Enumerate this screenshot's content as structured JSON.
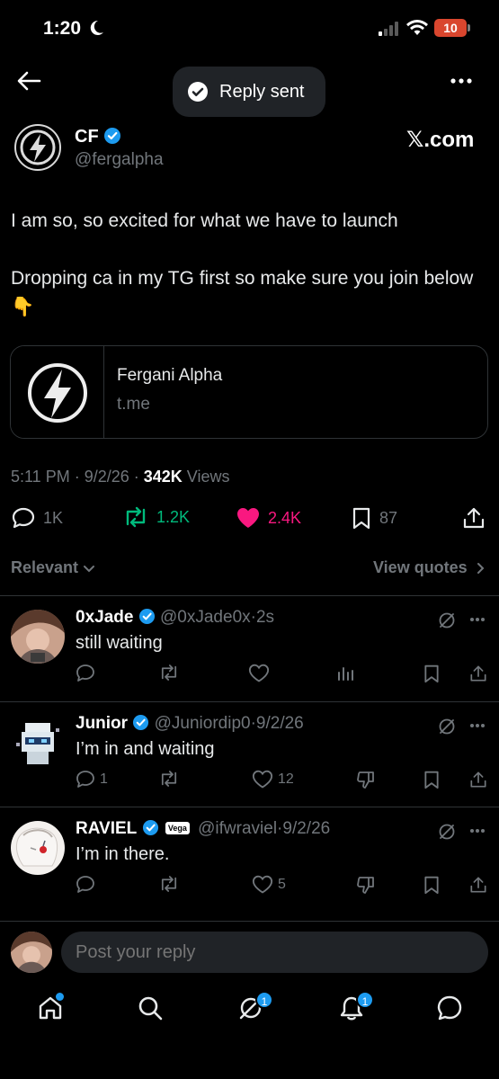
{
  "status_bar": {
    "time": "1:20",
    "battery": "10"
  },
  "toast": {
    "text": "Reply sent"
  },
  "tweet": {
    "author_name": "CF",
    "author_handle": "@fergalpha",
    "source_badge": "𝕏.com",
    "text": "I am so, so excited for what we have to launch\n\nDropping ca in my TG first so make sure you join below 👇",
    "card": {
      "title": "Fergani Alpha",
      "domain": "t.me"
    },
    "time": "5:11 PM",
    "date": "9/2/26",
    "views_count": "342K",
    "views_label": "Views",
    "replies": "1K",
    "reposts": "1.2K",
    "likes": "2.4K",
    "bookmarks": "87"
  },
  "sort": {
    "label": "Relevant",
    "view_quotes": "View quotes"
  },
  "replies": [
    {
      "name": "0xJade",
      "handle": "@0xJade0x",
      "time": "2s",
      "text": "still waiting",
      "reply_count": "",
      "like_count": ""
    },
    {
      "name": "Junior",
      "handle": "@Juniordip0",
      "time": "9/2/26",
      "text": "I’m in and waiting",
      "reply_count": "1",
      "like_count": "12"
    },
    {
      "name": "RAVIEL",
      "handle": "@ifwraviel",
      "time": "9/2/26",
      "text": "I’m in there.",
      "badge": "Vega",
      "reply_count": "",
      "like_count": "5"
    }
  ],
  "composer": {
    "placeholder": "Post your reply"
  },
  "nav_badges": {
    "grok": "1",
    "notifications": "1"
  },
  "colors": {
    "accent": "#1d9bf0",
    "repost": "#00ba7c",
    "like": "#f91880",
    "background": "#000000"
  }
}
